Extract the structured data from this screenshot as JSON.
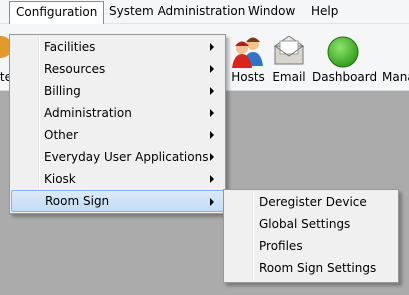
{
  "menubar": {
    "items": [
      "Configuration",
      "System Administration",
      "Window",
      "Help"
    ]
  },
  "toolbar": {
    "partial_left": "te",
    "hosts_label": "Hosts",
    "email_label": "Email",
    "dashboard_label": "Dashboard",
    "partial_right": "Mana"
  },
  "configuration_menu": {
    "items": [
      {
        "label": "Facilities"
      },
      {
        "label": "Resources"
      },
      {
        "label": "Billing"
      },
      {
        "label": "Administration"
      },
      {
        "label": "Other"
      },
      {
        "label": "Everyday User Applications"
      },
      {
        "label": "Kiosk"
      },
      {
        "label": "Room Sign"
      }
    ],
    "highlighted": "Room Sign"
  },
  "room_sign_submenu": {
    "items": [
      "Deregister Device",
      "Global Settings",
      "Profiles",
      "Room Sign Settings"
    ]
  },
  "colors": {
    "highlight": "#c3dcf5",
    "workspace": "#ababab",
    "dashboard_icon": "#3cb521"
  }
}
